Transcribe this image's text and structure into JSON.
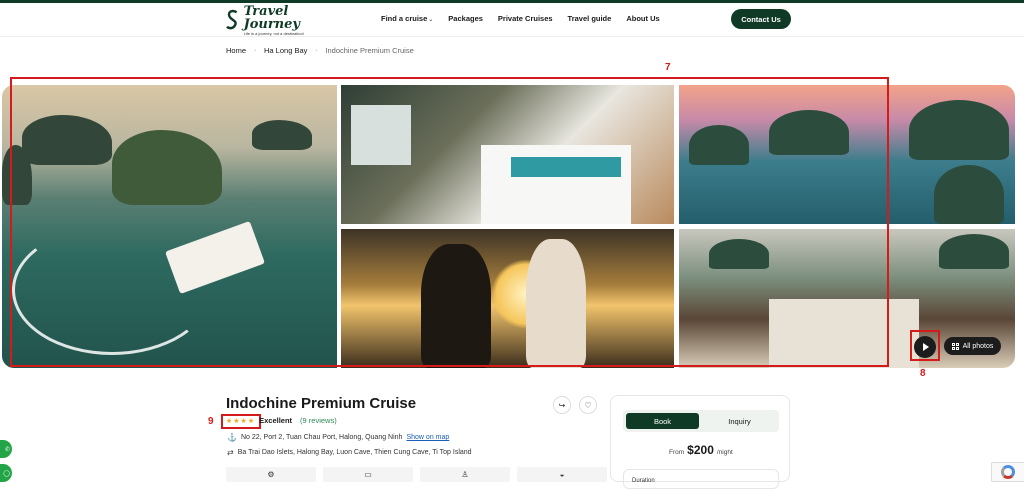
{
  "brand": {
    "name": "Travel Journey",
    "tagline": "Life is a journey, not a destination!"
  },
  "nav": {
    "items": [
      "Find a cruise",
      "Packages",
      "Private Cruises",
      "Travel guide",
      "About Us"
    ],
    "contact_label": "Contact Us"
  },
  "breadcrumb": {
    "items": [
      "Home",
      "Ha Long Bay",
      "Indochine Premium Cruise"
    ]
  },
  "gallery": {
    "all_photos_label": "All photos",
    "photos": [
      "main-cruise-aerial",
      "cabin-bedroom",
      "bay-sunset-aerial",
      "couple-sunset",
      "deck-dining"
    ]
  },
  "annotations": {
    "gallery_label": "7",
    "play_label": "8",
    "rating_label": "9"
  },
  "listing": {
    "title": "Indochine Premium Cruise",
    "rating_stars": "★★★★",
    "rating_text": "Excellent",
    "reviews": "(9 reviews)",
    "address": "No 22, Port 2, Tuan Chau Port, Halong, Quang Ninh",
    "map_link": "Show on map",
    "route": "Ba Trai Dao Islets, Halong Bay, Luon Cave, Thien Cung Cave, Ti Top Island",
    "feature_icons": [
      "⚙",
      "▭",
      "♙",
      "◒"
    ]
  },
  "booking": {
    "tab_book": "Book",
    "tab_inquiry": "Inquiry",
    "price_prefix": "From",
    "price_amount": "$200",
    "price_suffix": "/night",
    "duration_label": "Duration"
  },
  "colors": {
    "brand_green": "#0f3b26",
    "annotation_red": "#d41a1a",
    "star_gold": "#f2a81d",
    "link_blue": "#1a5fb4"
  }
}
